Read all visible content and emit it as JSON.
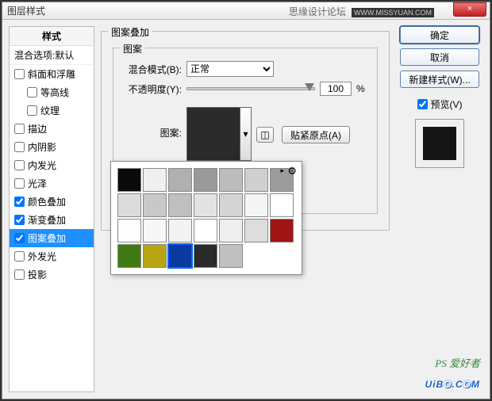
{
  "titlebar": {
    "title": "图层样式",
    "forum": "思缘设计论坛",
    "forum_url": "WWW.MISSYUAN.COM",
    "close": "×"
  },
  "left": {
    "header": "样式",
    "sub": "混合选项:默认",
    "items": [
      {
        "label": "斜面和浮雕",
        "checked": false,
        "indent": false
      },
      {
        "label": "等高线",
        "checked": false,
        "indent": true
      },
      {
        "label": "纹理",
        "checked": false,
        "indent": true
      },
      {
        "label": "描边",
        "checked": false,
        "indent": false
      },
      {
        "label": "内阴影",
        "checked": false,
        "indent": false
      },
      {
        "label": "内发光",
        "checked": false,
        "indent": false
      },
      {
        "label": "光泽",
        "checked": false,
        "indent": false
      },
      {
        "label": "颜色叠加",
        "checked": true,
        "indent": false
      },
      {
        "label": "渐变叠加",
        "checked": true,
        "indent": false
      },
      {
        "label": "图案叠加",
        "checked": true,
        "indent": false,
        "selected": true
      },
      {
        "label": "外发光",
        "checked": false,
        "indent": false
      },
      {
        "label": "投影",
        "checked": false,
        "indent": false
      }
    ]
  },
  "mid": {
    "group_title": "图案叠加",
    "inner_title": "图案",
    "blend_label": "混合模式(B):",
    "blend_value": "正常",
    "opacity_label": "不透明度(Y):",
    "opacity_value": "100",
    "pct": "%",
    "pattern_label": "图案:",
    "snap_label": "贴紧原点(A)"
  },
  "picker": {
    "gear": "⚙",
    "swatches": [
      "#0a0a0a",
      "#efefef",
      "#b0b0b0",
      "#9a9a9a",
      "#bcbcbc",
      "#cfcfcf",
      "#9c9c9c",
      "#dcdcdc",
      "#c8c8c8",
      "#bfbfbf",
      "#e2e2e2",
      "#d4d4d4",
      "#f5f5f5",
      "#ffffff",
      "#fdfdfd",
      "#f7f7f7",
      "#f2f2f2",
      "#ffffff",
      "#eeeeee",
      "#dddddd",
      "#a01515",
      "#3f7a12",
      "#b8a514",
      "#0a3aa0",
      "#2a2a2a",
      "#c0c0c0"
    ],
    "selected": 23
  },
  "right": {
    "ok": "确定",
    "cancel": "取消",
    "newstyle": "新建样式(W)...",
    "preview_label": "预览(V)",
    "preview_checked": true
  },
  "watermark": {
    "small": "PS 爱好者",
    "main_pre": "UiB",
    "main_o1": "O",
    "main_mid": ".C",
    "main_o2": "O",
    "main_end": "M"
  }
}
